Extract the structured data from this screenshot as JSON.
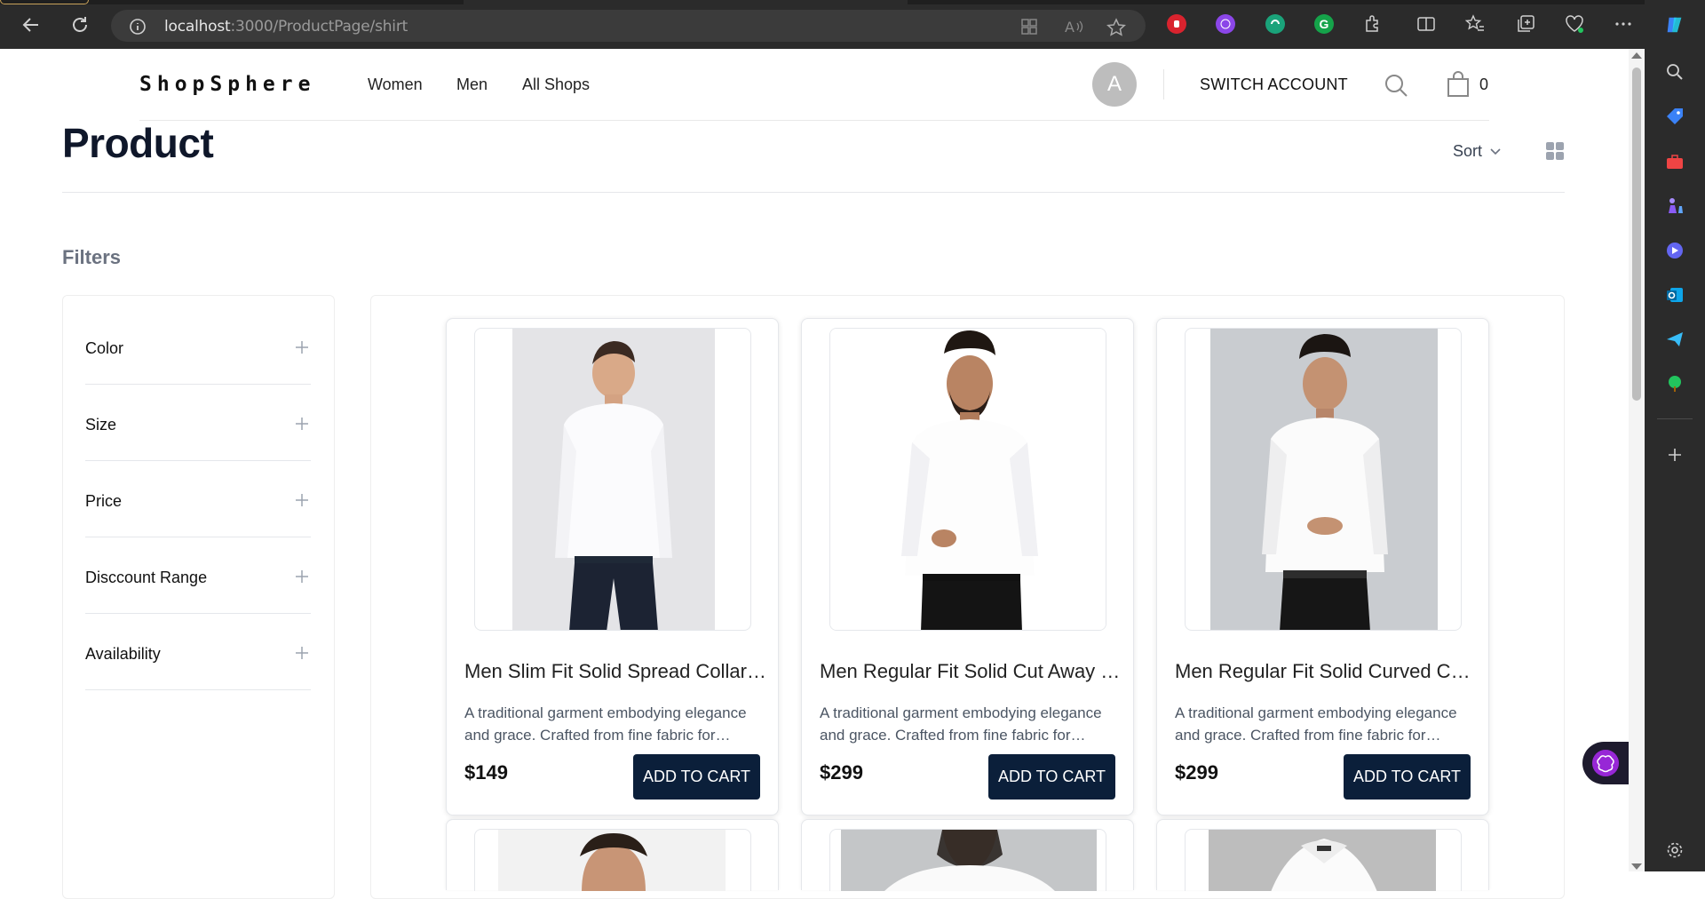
{
  "browser": {
    "url_host": "localhost",
    "url_path": ":3000/ProductPage/shirt"
  },
  "header": {
    "logo": "ShopSphere",
    "nav": [
      "Women",
      "Men",
      "All Shops"
    ],
    "avatar_initial": "A",
    "switch_account": "SWITCH ACCOUNT",
    "cart_count": "0"
  },
  "page": {
    "title": "Product",
    "sort_label": "Sort",
    "filters_title": "Filters"
  },
  "filters": [
    {
      "label": "Color"
    },
    {
      "label": "Size"
    },
    {
      "label": "Price"
    },
    {
      "label": "Disccount Range"
    },
    {
      "label": "Availability"
    }
  ],
  "products": [
    {
      "name": "Men Slim Fit Solid Spread Collar Formal Shirt",
      "description": "A traditional garment embodying elegance and grace. Crafted from fine fabric for everyday wear.",
      "price": "$149",
      "button": "ADD TO CART"
    },
    {
      "name": "Men Regular Fit Solid Cut Away Collar Shirt",
      "description": "A traditional garment embodying elegance and grace. Crafted from fine fabric for everyday wear.",
      "price": "$299",
      "button": "ADD TO CART"
    },
    {
      "name": "Men Regular Fit Solid Curved Collar Shirt",
      "description": "A traditional garment embodying elegance and grace. Crafted from fine fabric for everyday wear.",
      "price": "$299",
      "button": "ADD TO CART"
    }
  ],
  "colors": {
    "button_bg": "#0b1f3a",
    "title": "#0f172a",
    "chrome": "#2b2b2b"
  }
}
